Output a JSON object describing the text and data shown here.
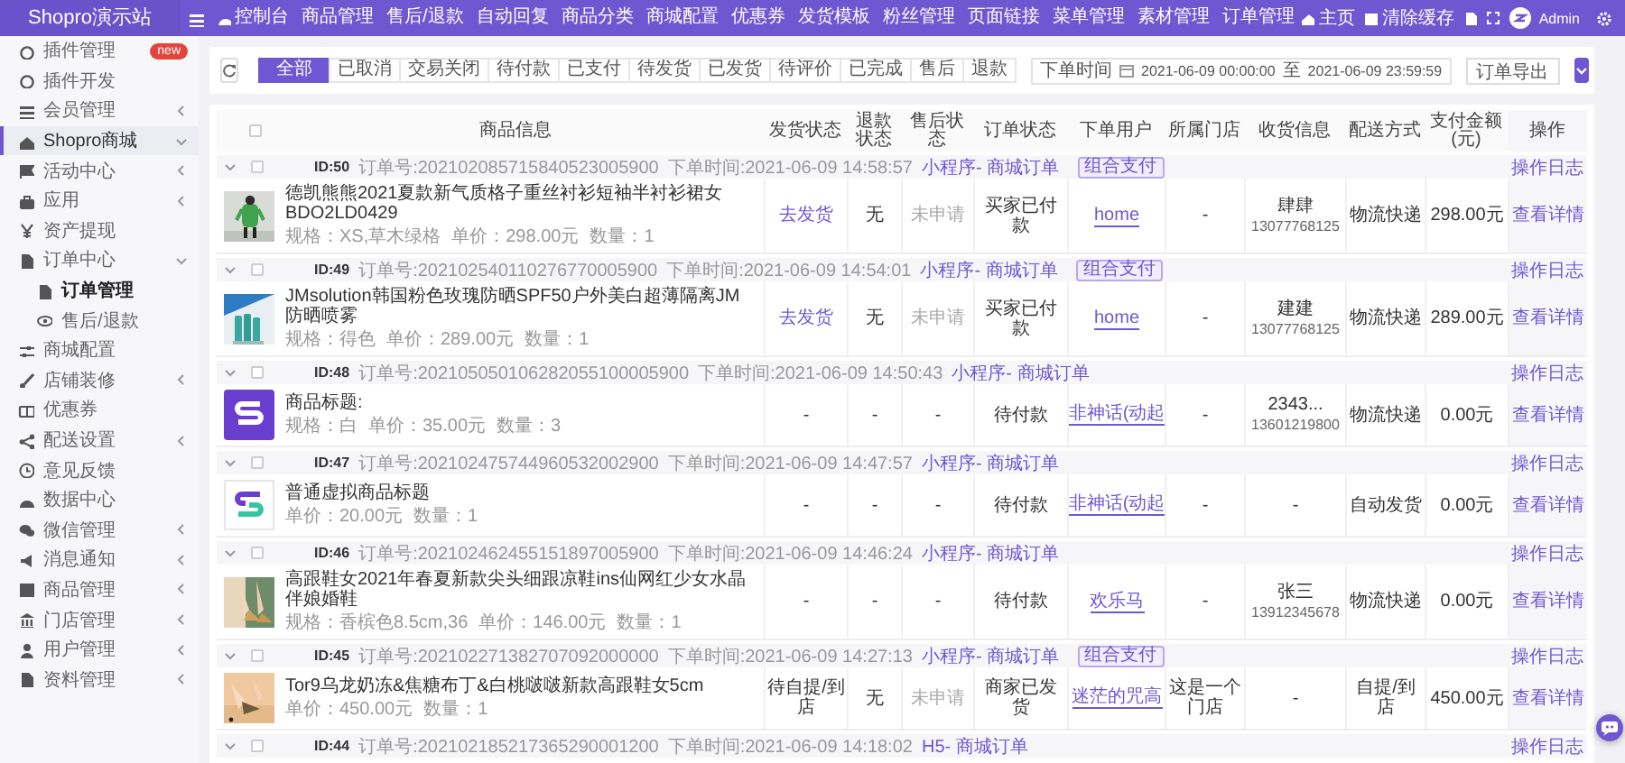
{
  "brand": "Shopro演示站",
  "topnav": {
    "items": [
      "控制台",
      "商品管理",
      "售后/退款",
      "自动回复",
      "商品分类",
      "商城配置",
      "优惠券",
      "发货模板",
      "粉丝管理",
      "页面链接",
      "菜单管理",
      "素材管理",
      "订单管理"
    ],
    "right": [
      {
        "kind": "home",
        "label": "主页"
      },
      {
        "kind": "clear",
        "label": "清除缓存"
      },
      {
        "kind": "translate"
      },
      {
        "kind": "fullscreen"
      }
    ],
    "user": "Admin"
  },
  "sidebar": {
    "items": [
      {
        "label": "插件管理",
        "badge": "new",
        "selected": false
      },
      {
        "label": "插件开发",
        "selected": false
      },
      {
        "label": "会员管理",
        "expanded": false,
        "selected": false
      },
      {
        "label": "Shopro商城",
        "expanded": true,
        "selected": true
      },
      {
        "label": "活动中心",
        "expanded": false,
        "selected": false
      },
      {
        "label": "应用",
        "expanded": false,
        "selected": false
      },
      {
        "label": "资产提现",
        "selected": false
      },
      {
        "label": "订单中心",
        "expanded": true,
        "selected": false,
        "children": [
          {
            "label": "订单管理",
            "selected": true
          },
          {
            "label": "售后/退款",
            "selected": false
          }
        ]
      },
      {
        "label": "商城配置",
        "selected": false
      },
      {
        "label": "店铺装修",
        "expanded": false,
        "selected": false
      },
      {
        "label": "优惠券",
        "selected": false
      },
      {
        "label": "配送设置",
        "expanded": false,
        "selected": false
      },
      {
        "label": "意见反馈",
        "selected": false
      },
      {
        "label": "数据中心",
        "selected": false
      },
      {
        "label": "微信管理",
        "expanded": false,
        "selected": false
      },
      {
        "label": "消息通知",
        "expanded": false,
        "selected": false
      },
      {
        "label": "商品管理",
        "expanded": false,
        "selected": false
      },
      {
        "label": "门店管理",
        "expanded": false,
        "selected": false
      },
      {
        "label": "用户管理",
        "expanded": false,
        "selected": false
      },
      {
        "label": "资料管理",
        "expanded": false,
        "selected": false
      }
    ]
  },
  "filters": {
    "tabs": [
      {
        "label": "全部",
        "selected": true
      },
      {
        "label": "已取消",
        "selected": false
      },
      {
        "label": "交易关闭",
        "selected": false
      },
      {
        "label": "待付款",
        "selected": false
      },
      {
        "label": "已支付",
        "selected": false
      },
      {
        "label": "待发货",
        "selected": false
      },
      {
        "label": "已发货",
        "selected": false
      },
      {
        "label": "待评价",
        "selected": false
      },
      {
        "label": "已完成",
        "selected": false
      },
      {
        "label": "售后",
        "selected": false
      },
      {
        "label": "退款",
        "selected": false
      }
    ],
    "date_label": "下单时间",
    "start": "2021-06-09 00:00:00",
    "separator": "至",
    "end": "2021-06-09 23:59:59",
    "export": "订单导出"
  },
  "table": {
    "select_all_checked": false,
    "columns": [
      "商品信息",
      "发货状态",
      "退款状态",
      "售后状态",
      "订单状态",
      "下单用户",
      "所属门店",
      "收货信息",
      "配送方式",
      "支付金额(元)",
      "操作"
    ],
    "orders": [
      {
        "checked": false,
        "id": "ID:50",
        "order_no": "订单号:202102085715840523005900",
        "time": "下单时间:2021-06-09 14:58:57",
        "source": "小程序- 商城订单",
        "badge": "组合支付",
        "log": "操作日志",
        "title": "德凯熊熊2021夏款新气质格子重丝衬衫短袖半衬衫裙女BDO2LD0429",
        "spec": "规格：XS,草木绿格",
        "price": "单价：298.00元",
        "qty": "数量：1",
        "shipping": {
          "text": "去发货",
          "kind": "link"
        },
        "refund": "无",
        "aftersale": {
          "text": "未申请",
          "kind": "muted"
        },
        "status": "买家已付款",
        "user": "home",
        "store": "-",
        "receiver": {
          "name": "肆肆",
          "phone": "13077768125"
        },
        "delivery": "物流快递",
        "amount": "298.00元",
        "detail": "查看详情"
      },
      {
        "checked": false,
        "id": "ID:49",
        "order_no": "订单号:202102540110276770005900",
        "time": "下单时间:2021-06-09 14:54:01",
        "source": "小程序- 商城订单",
        "badge": "组合支付",
        "log": "操作日志",
        "title": "JMsolution韩国粉色玫瑰防晒SPF50户外美白超薄隔离JM防晒喷雾",
        "spec": "规格：得色",
        "price": "单价：289.00元",
        "qty": "数量：1",
        "shipping": {
          "text": "去发货",
          "kind": "link"
        },
        "refund": "无",
        "aftersale": {
          "text": "未申请",
          "kind": "muted"
        },
        "status": "买家已付款",
        "user": "home",
        "store": "-",
        "receiver": {
          "name": "建建",
          "phone": "13077768125"
        },
        "delivery": "物流快递",
        "amount": "289.00元",
        "detail": "查看详情"
      },
      {
        "checked": false,
        "id": "ID:48",
        "order_no": "订单号:202105050106282055100005900",
        "time": "下单时间:2021-06-09 14:50:43",
        "source": "小程序- 商城订单",
        "log": "操作日志",
        "thumb": {
          "kind": "logo-dark"
        },
        "title": "商品标题:",
        "spec": "规格：白",
        "price": "单价：35.00元",
        "qty": "数量：3",
        "shipping": {
          "text": "-",
          "kind": "text"
        },
        "refund": "-",
        "aftersale": {
          "text": "-",
          "kind": "text"
        },
        "status": "待付款",
        "user": "非神话(动起",
        "store": "-",
        "receiver": {
          "name": "2343...",
          "phone": "13601219800"
        },
        "delivery": "物流快递",
        "amount": "0.00元",
        "detail": "查看详情"
      },
      {
        "checked": false,
        "id": "ID:47",
        "order_no": "订单号:202102475744960532002900",
        "time": "下单时间:2021-06-09 14:47:57",
        "source": "小程序- 商城订单",
        "log": "操作日志",
        "thumb": {
          "kind": "logo-light"
        },
        "title": "普通虚拟商品标题",
        "price": "单价：20.00元",
        "qty": "数量：1",
        "shipping": {
          "text": "-",
          "kind": "text"
        },
        "refund": "-",
        "aftersale": {
          "text": "-",
          "kind": "text"
        },
        "status": "待付款",
        "user": "非神话(动起",
        "store": "-",
        "receiver": {
          "name": "-"
        },
        "delivery": "自动发货",
        "amount": "0.00元",
        "detail": "查看详情"
      },
      {
        "checked": false,
        "id": "ID:46",
        "order_no": "订单号:202102462455151897005900",
        "time": "下单时间:2021-06-09 14:46:24",
        "source": "小程序- 商城订单",
        "log": "操作日志",
        "title": "高跟鞋女2021年春夏新款尖头细跟凉鞋ins仙网红少女水晶伴娘婚鞋",
        "spec": "规格：香槟色8.5cm,36",
        "price": "单价：146.00元",
        "qty": "数量：1",
        "shipping": {
          "text": "-",
          "kind": "text"
        },
        "refund": "-",
        "aftersale": {
          "text": "-",
          "kind": "text"
        },
        "status": "待付款",
        "user": "欢乐马",
        "store": "-",
        "receiver": {
          "name": "张三",
          "phone": "13912345678"
        },
        "delivery": "物流快递",
        "amount": "0.00元",
        "detail": "查看详情"
      },
      {
        "checked": false,
        "id": "ID:45",
        "order_no": "订单号:202102271382707092000000",
        "time": "下单时间:2021-06-09 14:27:13",
        "source": "小程序- 商城订单",
        "badge": "组合支付",
        "log": "操作日志",
        "title": "Tor9乌龙奶冻&焦糖布丁&白桃啵啵新款高跟鞋女5cm",
        "price": "单价：450.00元",
        "qty": "数量：1",
        "shipping": {
          "text": "待自提/到店",
          "kind": "text"
        },
        "refund": "无",
        "aftersale": {
          "text": "未申请",
          "kind": "muted"
        },
        "status": "商家已发货",
        "user": "迷茫的咒高",
        "store": "这是一个门店",
        "receiver": {
          "name": "-"
        },
        "delivery": "自提/到店",
        "amount": "450.00元",
        "detail": "查看详情"
      },
      {
        "checked": false,
        "id": "ID:44",
        "order_no": "订单号:202102185217365290001200",
        "time": "下单时间:2021-06-09 14:18:02",
        "source": "H5- 商城订单",
        "log": "操作日志"
      }
    ]
  }
}
